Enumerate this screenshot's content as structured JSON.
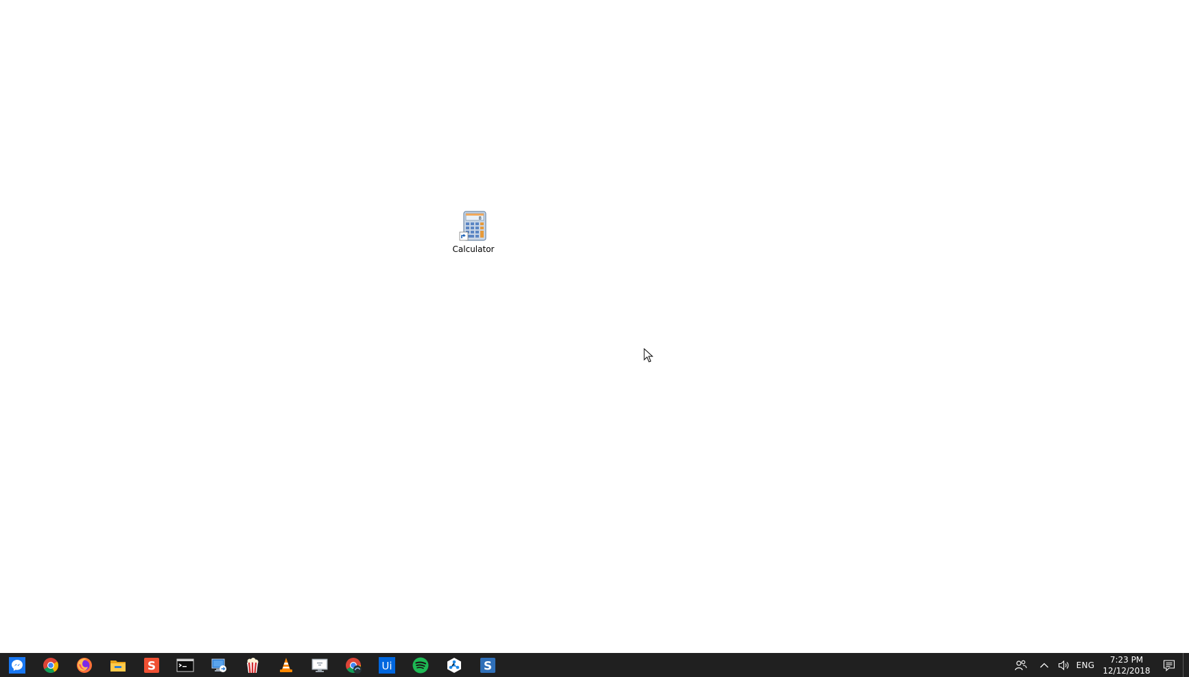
{
  "desktop": {
    "icons": [
      {
        "label": "Calculator",
        "icon": "calculator-icon"
      }
    ]
  },
  "taskbar": {
    "pinned_apps": [
      {
        "name": "messenger",
        "icon": "messenger-icon",
        "color": "#0078FF"
      },
      {
        "name": "chrome",
        "icon": "chrome-icon",
        "color": "#4285F4"
      },
      {
        "name": "firefox",
        "icon": "firefox-icon",
        "color": "#FF7139"
      },
      {
        "name": "file-explorer",
        "icon": "folder-icon",
        "color": "#F8C440"
      },
      {
        "name": "sublime",
        "icon": "sublime-s-icon",
        "color": "#F05033"
      },
      {
        "name": "terminal",
        "icon": "terminal-icon",
        "color": "#000000"
      },
      {
        "name": "remote-desktop",
        "icon": "remote-desktop-icon",
        "color": "#2B7CD3"
      },
      {
        "name": "popcorn",
        "icon": "popcorn-icon",
        "color": "#D32F2F"
      },
      {
        "name": "vlc",
        "icon": "vlc-cone-icon",
        "color": "#FF8800"
      },
      {
        "name": "display",
        "icon": "monitor-icon",
        "color": "#BFC6CC"
      },
      {
        "name": "chrome-dev",
        "icon": "chrome-dev-icon",
        "color": "#4285F4"
      },
      {
        "name": "uipath",
        "icon": "uipath-icon",
        "color": "#0067DF",
        "text": "Ui"
      },
      {
        "name": "spotify",
        "icon": "spotify-icon",
        "color": "#1DB954"
      },
      {
        "name": "network-app",
        "icon": "hex-network-icon",
        "color": "#1E88E5"
      },
      {
        "name": "snagit",
        "icon": "snagit-s-icon",
        "color": "#2F6FB8"
      }
    ],
    "tray": {
      "language": "ENG",
      "time": "7:23 PM",
      "date": "12/12/2018"
    }
  }
}
